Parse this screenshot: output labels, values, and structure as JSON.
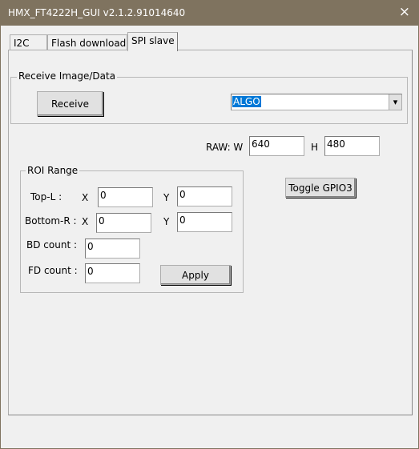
{
  "window": {
    "title": "HMX_FT4222H_GUI v2.1.2.91014640",
    "close_icon": "×"
  },
  "tabs": [
    {
      "label": "I2C"
    },
    {
      "label": "Flash download"
    },
    {
      "label": "SPI slave",
      "active": true
    }
  ],
  "receive_group": {
    "legend": "Receive Image/Data",
    "receive_label": "Receive",
    "mode_value": "ALGO",
    "arrow": "▾"
  },
  "raw": {
    "w_label": "RAW: W",
    "w_value": "640",
    "h_label": "H",
    "h_value": "480"
  },
  "toggle_label": "Toggle GPIO3",
  "roi": {
    "legend": "ROI Range",
    "top_l_label": "Top-L :",
    "bottom_r_label": "Bottom-R :",
    "x_label": "X",
    "y_label": "Y",
    "top_x": "0",
    "top_y": "0",
    "bottom_x": "0",
    "bottom_y": "0",
    "bd_label": "BD count :",
    "bd_value": "0",
    "fd_label": "FD count :",
    "fd_value": "0",
    "apply_label": "Apply"
  },
  "colors": {
    "titlebar": "#7f735f",
    "selection": "#0078d7"
  }
}
